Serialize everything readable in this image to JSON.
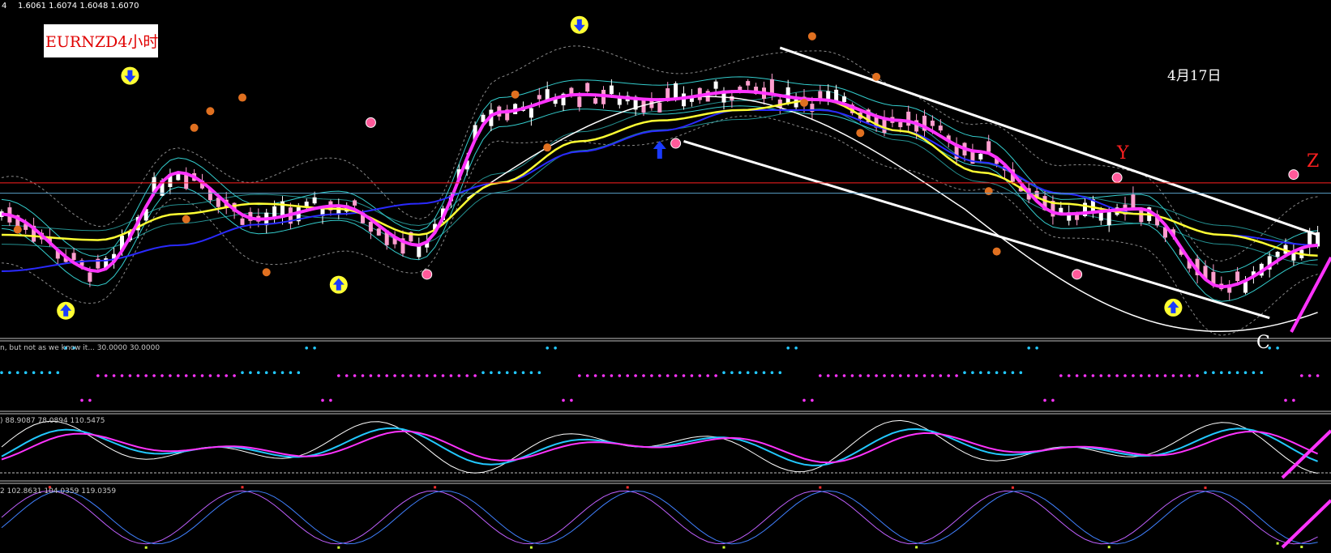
{
  "header": {
    "symbol_tag": "4",
    "ohlc": "1.6061 1.6074 1.6048 1.6070",
    "title_box": "EURNZD4小时"
  },
  "annotations": {
    "date": "4月17日",
    "wave_y": "Y",
    "wave_z": "Z",
    "wave_c": "C"
  },
  "panels": {
    "p1_label": "n, but not as we know it...  30.0000 30.0000",
    "p2_label": ") 88.9087 78.0894 110.5475",
    "p3_label": "2 102.8631 104.0359 119.0359"
  },
  "colors": {
    "background": "#000000",
    "bull_candle": "#ffffff",
    "bear_candle": "#ff9fcf",
    "fast_ma": "#ff33ff",
    "mid_ma": "#ffff33",
    "slow_ma": "#2a2aff",
    "long_ma": "#ffffff",
    "bands": "#33cccc",
    "red_level": "#ff2020",
    "cyan": "#22c8ff",
    "magenta": "#ff33ff"
  },
  "chart_data": {
    "type": "line",
    "note_axis": "bar index 0-164 (H4 bars)",
    "x": [
      0,
      12,
      22,
      32,
      42,
      52,
      62,
      72,
      82,
      92,
      102,
      112,
      122,
      132,
      142,
      152,
      164
    ],
    "series": [
      {
        "values": [
          1.604,
          1.5985,
          1.608,
          1.6035,
          1.6048,
          1.601,
          1.6138,
          1.6155,
          1.615,
          1.6158,
          1.615,
          1.613,
          1.61,
          1.604,
          1.6045,
          1.597,
          1.601
        ]
      },
      {
        "values": [
          1.602,
          1.6015,
          1.604,
          1.605,
          1.6045,
          1.602,
          1.607,
          1.611,
          1.613,
          1.614,
          1.615,
          1.612,
          1.608,
          1.605,
          1.604,
          1.602,
          1.6
        ]
      },
      {
        "values": [
          1.5985,
          1.5995,
          1.601,
          1.603,
          1.604,
          1.605,
          1.607,
          1.61,
          1.612,
          1.614,
          1.614,
          1.612,
          1.609,
          1.606,
          1.604,
          1.602,
          1.601
        ]
      }
    ],
    "level_lines": [
      1.607,
      1.606
    ],
    "channel": {
      "upper": [
        [
          97,
          1.62
        ],
        [
          164,
          1.602
        ]
      ],
      "lower": [
        [
          85,
          1.611
        ],
        [
          158,
          1.594
        ]
      ]
    },
    "lower_panels": 3
  }
}
